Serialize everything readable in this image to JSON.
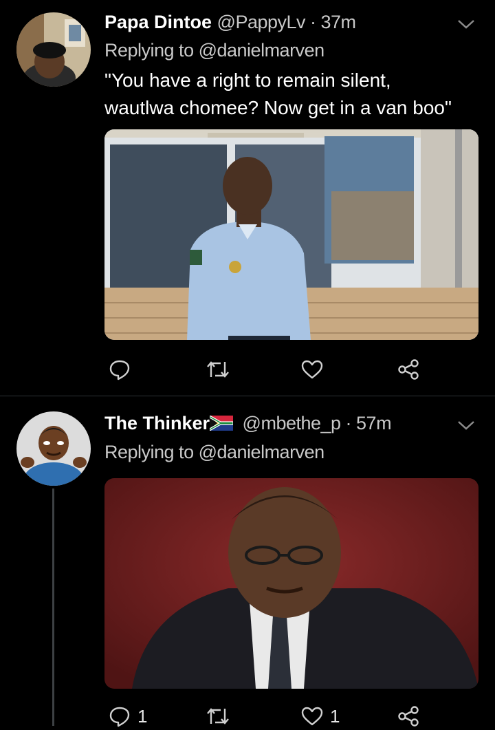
{
  "tweets": [
    {
      "name": "Papa Dintoe",
      "handle": "@PappyLv · 37m",
      "replying_prefix": "Replying to ",
      "replying_to": "@danielmarven",
      "text_line1": "\"You have a right to remain silent,",
      "text_line2": "wautlwa chomee? Now get in a van boo\"",
      "reply_count": "",
      "retweet_count": "",
      "like_count": ""
    },
    {
      "name": "The Thinker",
      "flag": "🇿🇦",
      "handle": "@mbethe_p · 57m",
      "replying_prefix": "Replying to ",
      "replying_to": "@danielmarven",
      "reply_count": "1",
      "retweet_count": "",
      "like_count": "1"
    }
  ],
  "icons": [
    "chevron-down-icon",
    "reply-icon",
    "retweet-icon",
    "like-icon",
    "share-icon"
  ],
  "colors": {
    "background": "#000000",
    "secondary_text": "#c9c9c9",
    "divider": "#2f3336"
  }
}
